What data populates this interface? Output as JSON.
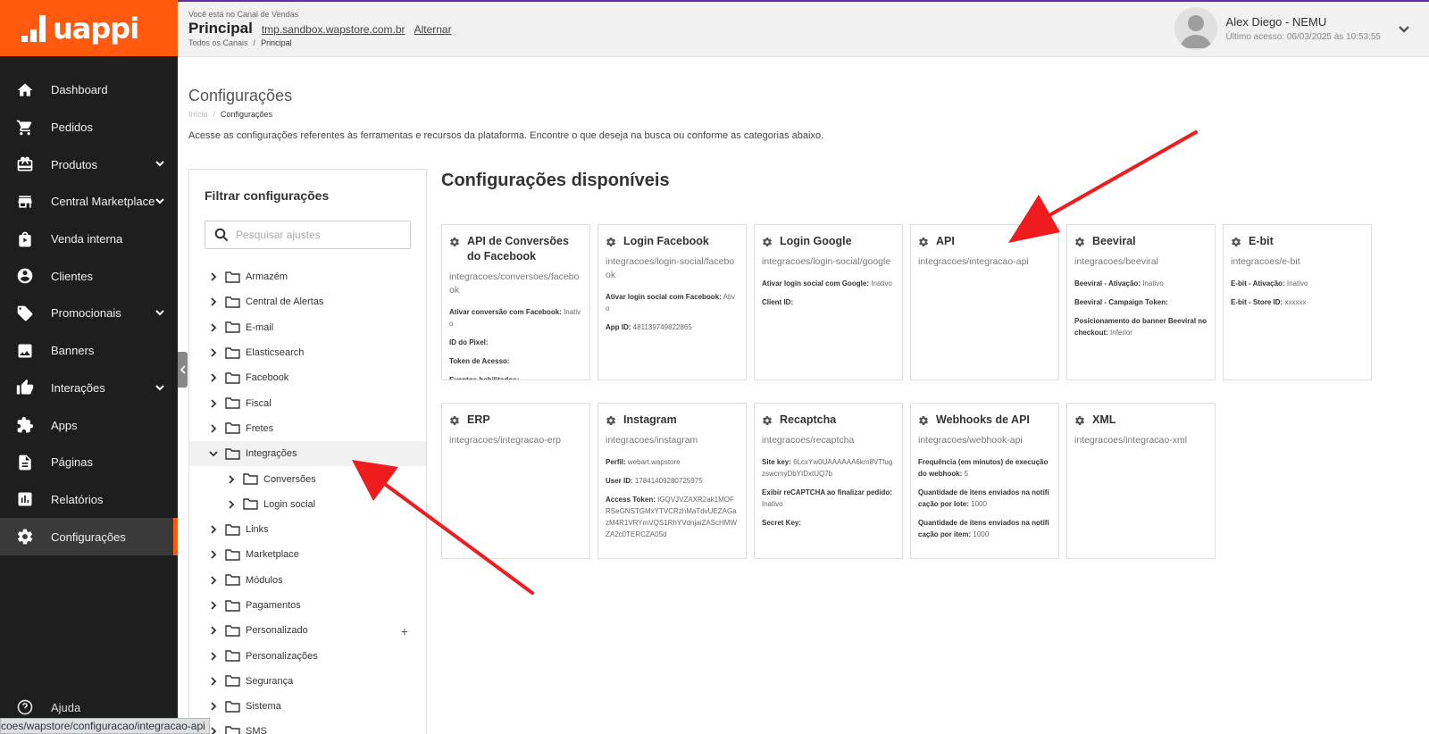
{
  "brand": {
    "logo_text": "uappi",
    "accent": "#ff5a0d",
    "sidebar_bg": "#1e1e1e"
  },
  "sidebar": {
    "items": [
      {
        "label": "Dashboard",
        "icon": "home-icon"
      },
      {
        "label": "Pedidos",
        "icon": "cart-icon"
      },
      {
        "label": "Produtos",
        "icon": "box-icon"
      },
      {
        "label": "Central Marketplace",
        "icon": "store-icon"
      },
      {
        "label": "Venda interna",
        "icon": "bag-icon"
      },
      {
        "label": "Clientes",
        "icon": "user-icon"
      },
      {
        "label": "Promocionais",
        "icon": "tag-icon"
      },
      {
        "label": "Banners",
        "icon": "image-icon"
      },
      {
        "label": "Interações",
        "icon": "thumbs-icon"
      },
      {
        "label": "Apps",
        "icon": "puzzle-icon"
      },
      {
        "label": "Páginas",
        "icon": "page-icon"
      },
      {
        "label": "Relatórios",
        "icon": "chart-icon"
      },
      {
        "label": "Configurações",
        "icon": "gear-icon"
      }
    ],
    "help_label": "Ajuda",
    "status_url": "coes/wapstore/configuracao/integracao-api"
  },
  "header": {
    "channel_caption": "Você está no Canal de Vendas",
    "channel_title": "Principal",
    "channel_url": "tmp.sandbox.wapstore.com.br",
    "switch_label": "Alternar",
    "breadcrumb_all": "Todos os Canais",
    "breadcrumb_current": "Principal",
    "user_name": "Alex Diego - NEMU",
    "user_last_access": "Último acesso: 06/03/2025 às 10:53:55"
  },
  "page": {
    "title": "Configurações",
    "breadcrumb_home": "Início",
    "breadcrumb_current": "Configurações",
    "description": "Acesse as configurações referentes às ferramentas e recursos da plataforma. Encontre o que deseja na busca ou conforme as categorias abaixo."
  },
  "filter": {
    "title": "Filtrar configurações",
    "search_placeholder": "Pesquisar ajustes",
    "tree": [
      {
        "label": "Armazém"
      },
      {
        "label": "Central de Alertas"
      },
      {
        "label": "E-mail"
      },
      {
        "label": "Elasticsearch"
      },
      {
        "label": "Facebook"
      },
      {
        "label": "Fiscal"
      },
      {
        "label": "Fretes"
      },
      {
        "label": "Integrações"
      },
      {
        "label": "Conversões"
      },
      {
        "label": "Login social"
      },
      {
        "label": "Links"
      },
      {
        "label": "Marketplace"
      },
      {
        "label": "Módulos"
      },
      {
        "label": "Pagamentos"
      },
      {
        "label": "Personalizado"
      },
      {
        "label": "Personalizações"
      },
      {
        "label": "Segurança"
      },
      {
        "label": "Sistema"
      },
      {
        "label": "SMS"
      }
    ]
  },
  "configs": {
    "title": "Configurações disponíveis",
    "cards": [
      {
        "title": "API de Conversões do Facebook",
        "path": "integracoes/conversoes/facebook",
        "fields": [
          {
            "label": "Ativar conversão com Facebook:",
            "value": "Inativo"
          },
          {
            "label": "ID do Pixel:",
            "value": ""
          },
          {
            "label": "Token de Acesso:",
            "value": ""
          },
          {
            "label": "Eventos habilitados:",
            "value": ""
          }
        ]
      },
      {
        "title": "Login Facebook",
        "path": "integracoes/login-social/facebook",
        "fields": [
          {
            "label": "Ativar login social com Facebook:",
            "value": "Ativo"
          },
          {
            "label": "App ID:",
            "value": "481139749822865"
          }
        ]
      },
      {
        "title": "Login Google",
        "path": "integracoes/login-social/google",
        "fields": [
          {
            "label": "Ativar login social com Google:",
            "value": "Inativo"
          },
          {
            "label": "Client ID:",
            "value": ""
          }
        ]
      },
      {
        "title": "API",
        "path": "integracoes/integracao-api",
        "fields": []
      },
      {
        "title": "Beeviral",
        "path": "integracoes/beeviral",
        "fields": [
          {
            "label": "Beeviral - Ativação:",
            "value": "Inativo"
          },
          {
            "label": "Beeviral - Campaign Token:",
            "value": ""
          },
          {
            "label": "Posicionamento do banner Beeviral no checkout:",
            "value": "Inferior"
          }
        ]
      },
      {
        "title": "E-bit",
        "path": "integracoes/e-bit",
        "fields": [
          {
            "label": "E-bit - Ativação:",
            "value": "Inativo"
          },
          {
            "label": "E-bit - Store ID:",
            "value": "xxxxxx"
          }
        ]
      },
      {
        "title": "ERP",
        "path": "integracoes/integracao-erp",
        "fields": []
      },
      {
        "title": "Instagram",
        "path": "integracoes/instagram",
        "fields": [
          {
            "label": "Perfil:",
            "value": "webart.wapstore"
          },
          {
            "label": "User ID:",
            "value": "17841409280725975"
          },
          {
            "label": "Access Token:",
            "value": "IGQVJVZAXR2ak1MOFRSeGNSTGMxYTVCRzhMaTdvUEZAGazM4R1VRYmVQS1RhYVdnjaiZAScHMWZA2c0TERCZA05d"
          }
        ]
      },
      {
        "title": "Recaptcha",
        "path": "integracoes/recaptcha",
        "fields": [
          {
            "label": "Site key:",
            "value": "6LcxYw0UAAAAAA6km8VTfugzswcmyDbYIDxtUQ7b"
          },
          {
            "label": "Exibir reCAPTCHA ao finalizar pedido:",
            "value": "Inativo"
          },
          {
            "label": "Secret Key:",
            "value": ""
          }
        ]
      },
      {
        "title": "Webhooks de API",
        "path": "integracoes/webhook-api",
        "fields": [
          {
            "label": "Frequência (em minutos) de execução do webhook:",
            "value": "5"
          },
          {
            "label": "Quantidade de itens enviados na notificação por lote:",
            "value": "1000"
          },
          {
            "label": "Quantidade de itens enviados na notificação por item:",
            "value": "1000"
          }
        ]
      },
      {
        "title": "XML",
        "path": "integracoes/integracao-xml",
        "fields": []
      }
    ]
  }
}
